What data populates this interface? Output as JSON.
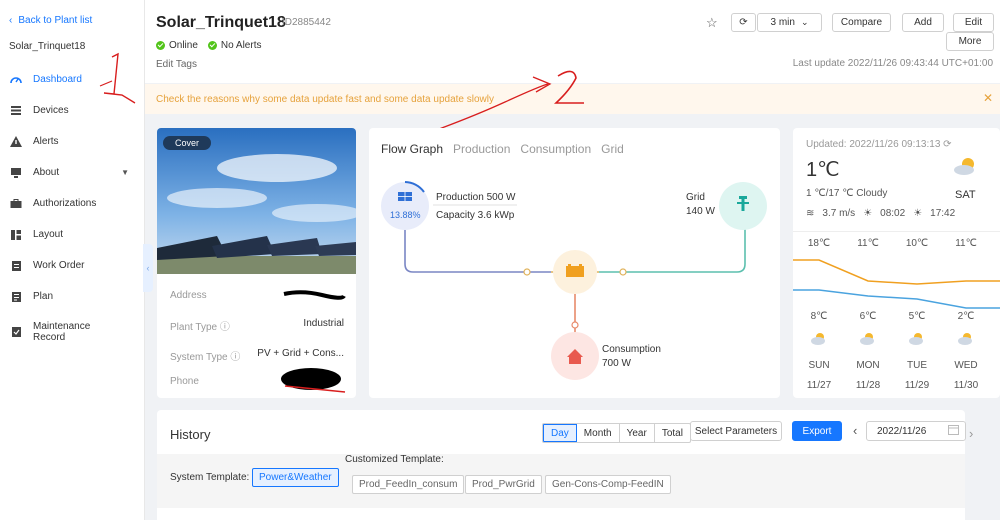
{
  "sidebar": {
    "back_label": "Back to Plant list",
    "plant_name": "Solar_Trinquet18",
    "items": [
      {
        "label": "Dashboard",
        "icon": "dashboard-icon",
        "active": true
      },
      {
        "label": "Devices",
        "icon": "devices-icon"
      },
      {
        "label": "Alerts",
        "icon": "alert-icon"
      },
      {
        "label": "About",
        "icon": "about-icon"
      },
      {
        "label": "Authorizations",
        "icon": "authorization-icon"
      },
      {
        "label": "Layout",
        "icon": "layout-icon"
      },
      {
        "label": "Work Order",
        "icon": "work-order-icon"
      },
      {
        "label": "Plan",
        "icon": "plan-icon"
      },
      {
        "label": "Maintenance Record",
        "icon": "maintenance-icon"
      }
    ]
  },
  "header": {
    "title": "Solar_Trinquet18",
    "id": "ID2885442",
    "status_online": "Online",
    "status_alerts": "No Alerts",
    "edit_tags": "Edit Tags",
    "refresh_interval": "3 min",
    "compare_label": "Compare",
    "add_label": "Add",
    "edit_label": "Edit",
    "more_label": "More",
    "last_update": "Last update 2022/11/26 09:43:44 UTC+01:00"
  },
  "notice": {
    "text": "Check the reasons why some data update fast and some data update slowly"
  },
  "annotations": {
    "one": "1",
    "two": "2"
  },
  "plant_card": {
    "cover_label": "Cover",
    "rows": [
      {
        "key": "Address",
        "value": ""
      },
      {
        "key": "Plant Type",
        "value": "Industrial"
      },
      {
        "key": "System Type",
        "value": "PV + Grid + Cons..."
      },
      {
        "key": "Phone",
        "value": ""
      }
    ]
  },
  "flow": {
    "tabs": [
      "Flow Graph",
      "Production",
      "Consumption",
      "Grid"
    ],
    "active_tab": 0,
    "production_percent": "13.88%",
    "production_label": "Production 500 W",
    "capacity_label": "Capacity 3.6 kWp",
    "grid_label": "Grid",
    "grid_value": "140 W",
    "consumption_label": "Consumption",
    "consumption_value": "700 W",
    "colors": {
      "production": "#2f6fd6",
      "grid": "#1aa89b",
      "battery": "#f0a020",
      "consumption": "#e85a4f"
    }
  },
  "weather": {
    "updated": "Updated:  2022/11/26 09:13:13",
    "temp_now": "1℃",
    "range": "1 ℃/17 ℃ Cloudy",
    "wind": "3.7 m/s",
    "sunrise": "08:02",
    "sunset": "17:42",
    "day_now": "SAT",
    "highs": [
      "18℃",
      "11℃",
      "10℃",
      "11℃"
    ],
    "lows": [
      "8℃",
      "6℃",
      "5℃",
      "2℃"
    ],
    "days": [
      "SUN",
      "MON",
      "TUE",
      "WED"
    ],
    "dates": [
      "11/27",
      "11/28",
      "11/29",
      "11/30"
    ],
    "high_levels": [
      18,
      11,
      10,
      11
    ],
    "low_levels": [
      8,
      6,
      5,
      2
    ]
  },
  "history": {
    "title": "History",
    "periods": [
      "Day",
      "Month",
      "Year",
      "Total"
    ],
    "active_period": 0,
    "select_params": "Select Parameters",
    "export_label": "Export",
    "date": "2022/11/26",
    "system_template_label": "System Template:",
    "system_template_value": "Power&Weather",
    "customized_label": "Customized Template:",
    "custom_templates": [
      "Prod_FeedIn_consum",
      "Prod_PwrGrid",
      "Gen-Cons-Comp-FeedIN"
    ]
  }
}
